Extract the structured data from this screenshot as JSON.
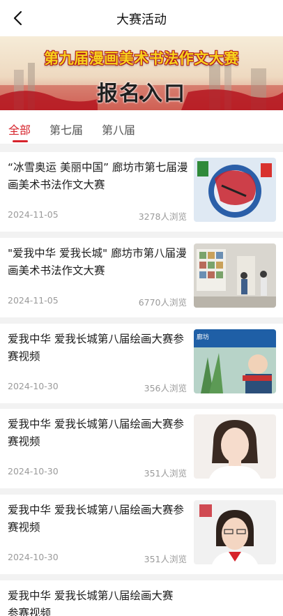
{
  "header": {
    "title": "大赛活动",
    "back_icon": "chevron-left-icon"
  },
  "banner": {
    "headline": "第九届漫画美术书法作文大赛",
    "signup": "报名入口"
  },
  "tabs": [
    {
      "label": "全部",
      "active": true
    },
    {
      "label": "第七届",
      "active": false
    },
    {
      "label": "第八届",
      "active": false
    }
  ],
  "colors": {
    "accent": "#d6232b",
    "muted": "#9a9a9a"
  },
  "articles": [
    {
      "title": "“冰雪奥运 美丽中国” 廊坊市第七届漫画美术书法作文大赛",
      "date": "2024-11-05",
      "views": "3278人浏览"
    },
    {
      "title": "\"爱我中华 爱我长城\" 廊坊市第八届漫画美术书法作文大赛",
      "date": "2024-11-05",
      "views": "6770人浏览"
    },
    {
      "title": "爱我中华 爱我长城第八届绘画大赛参赛视频",
      "date": "2024-10-30",
      "views": "356人浏览",
      "thumb_text": "廊坊"
    },
    {
      "title": "爱我中华 爱我长城第八届绘画大赛参赛视频",
      "date": "2024-10-30",
      "views": "351人浏览"
    },
    {
      "title": "爱我中华 爱我长城第八届绘画大赛参赛视频",
      "date": "2024-10-30",
      "views": "351人浏览"
    },
    {
      "title": "爱我中华 爱我长城第八届绘画大赛参赛视频",
      "date": "",
      "views": ""
    }
  ]
}
